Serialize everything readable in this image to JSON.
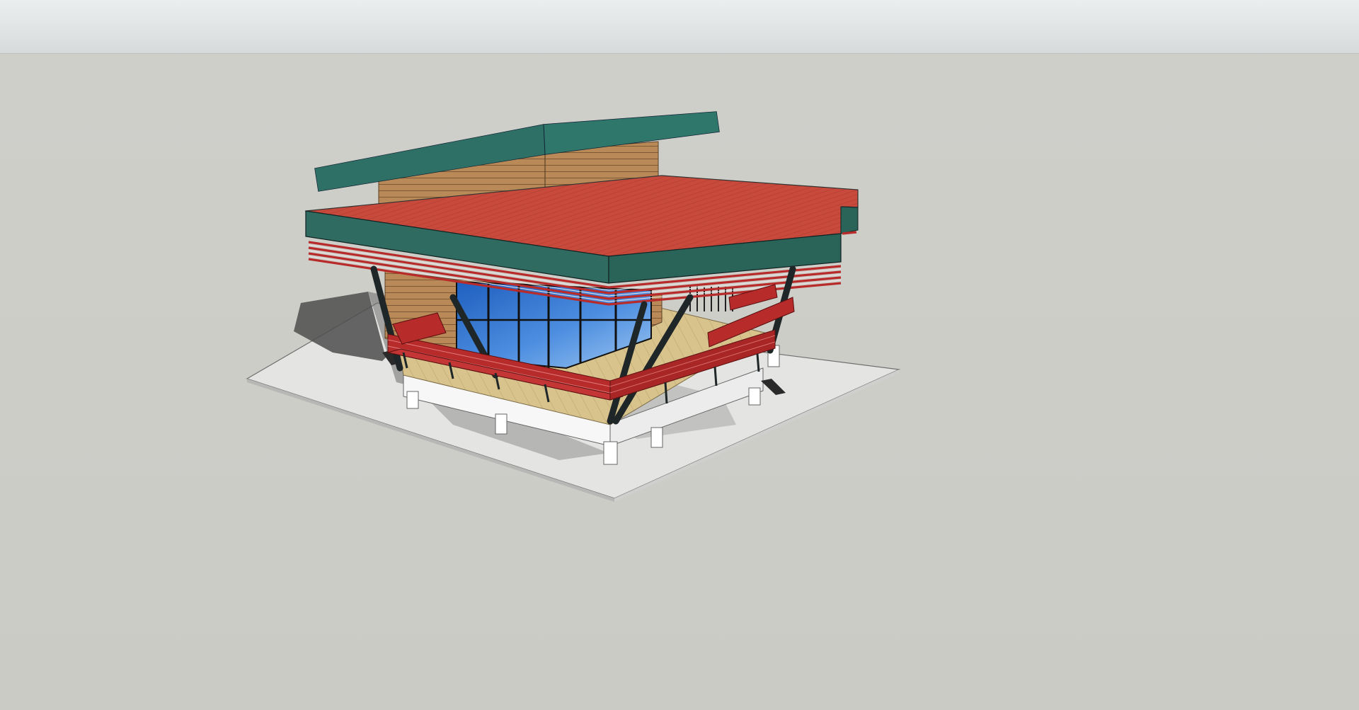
{
  "viewport": {
    "sky_color": "#e6e9ea",
    "ground_color": "#cdcdc8"
  },
  "model": {
    "roof_color": "#c84a3c",
    "fascia_color": "#2f6b60",
    "upper_roof_color": "#2b6b61",
    "wood_color": "#b98a57",
    "glass_color": "#3d7fd6",
    "deck_color": "#d8c38d",
    "base_color": "#ffffff",
    "slab_color": "#e2e2e2",
    "steel_color": "#1f2628",
    "bench_color": "#b82b2b",
    "shadow_color": "#4a4a4a"
  }
}
